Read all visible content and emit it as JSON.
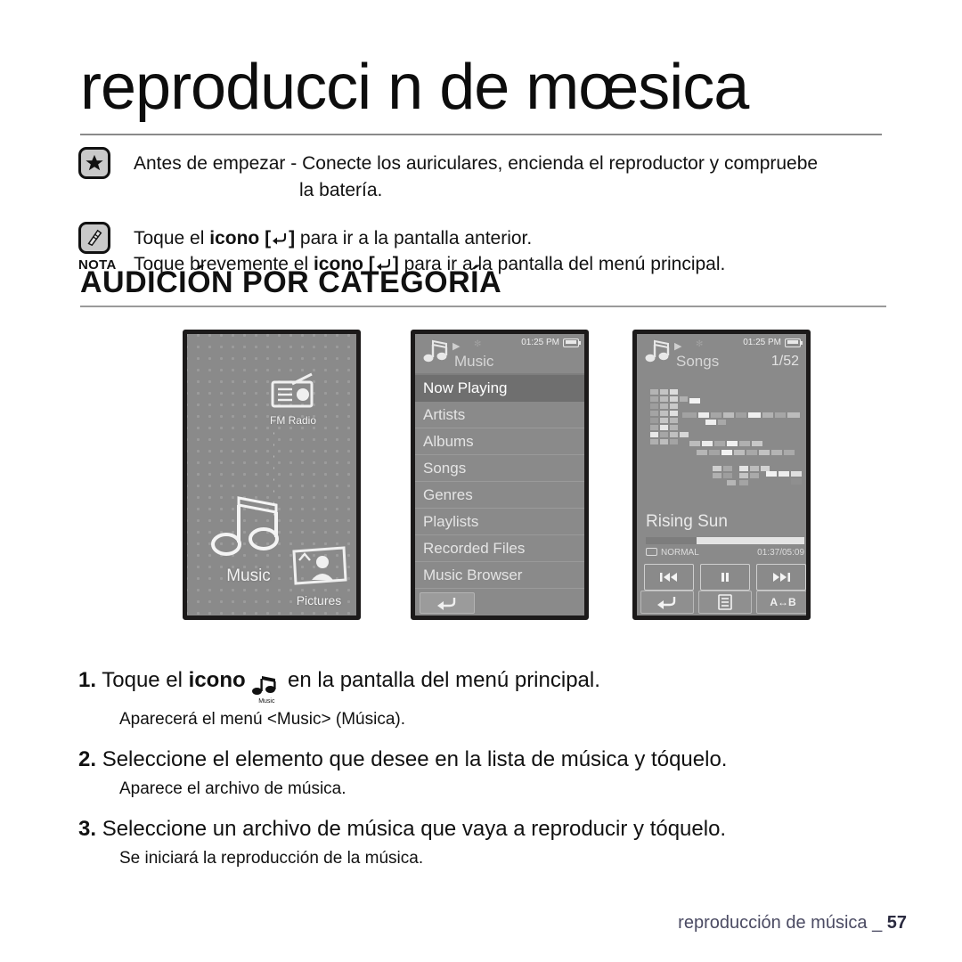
{
  "title": "reproducci n de mœsica",
  "notes": [
    {
      "icon": "star-icon",
      "label": "",
      "lines": [
        {
          "bold": "Antes de empezar - ",
          "text": "Conecte los auriculares, encienda el reproductor y compruebe",
          "indent": false
        },
        {
          "bold": "",
          "text": "la batería.",
          "indent": true
        }
      ]
    },
    {
      "icon": "note-pencil-icon",
      "label": "NOTA",
      "lines": [
        {
          "pre": "Toque el ",
          "bold": "icono [",
          "icon": "return-arrow-icon",
          "bold2": "]",
          "post": " para ir a la pantalla anterior."
        },
        {
          "pre": "Toque brevemente el ",
          "bold": "icono [",
          "icon": "return-arrow-icon",
          "bold2": "]",
          "post": " para ir a la pantalla del menú principal."
        }
      ]
    }
  ],
  "section": {
    "heading": "AUDICIÓN POR CATEGORÍA"
  },
  "devices": {
    "main_menu": {
      "icons": [
        {
          "name": "fm-radio-icon",
          "label": "FM Radio"
        },
        {
          "name": "music-icon",
          "label": "Music"
        },
        {
          "name": "pictures-icon",
          "label": "Pictures"
        }
      ]
    },
    "music_menu": {
      "header": {
        "title": "Music",
        "time": "01:25 PM",
        "battery": "full"
      },
      "items": [
        {
          "label": "Now Playing",
          "selected": true
        },
        {
          "label": "Artists",
          "selected": false
        },
        {
          "label": "Albums",
          "selected": false
        },
        {
          "label": "Songs",
          "selected": false
        },
        {
          "label": "Genres",
          "selected": false
        },
        {
          "label": "Playlists",
          "selected": false
        },
        {
          "label": "Recorded Files",
          "selected": false
        },
        {
          "label": "Music Browser",
          "selected": false
        }
      ],
      "back_button": "return-arrow-icon"
    },
    "now_playing": {
      "header": {
        "title": "Songs",
        "time": "01:25 PM",
        "count": "1/52",
        "battery": "full"
      },
      "track_title": "Rising Sun",
      "repeat_mode": "NORMAL",
      "elapsed_total": "01:37/05:09",
      "progress_percent": 32,
      "controls": [
        {
          "name": "previous-button",
          "glyph": "|◀◀"
        },
        {
          "name": "pause-button",
          "glyph": "❚❚"
        },
        {
          "name": "next-button",
          "glyph": "▶▶|"
        }
      ],
      "soft_keys": [
        {
          "name": "back-button",
          "glyph": ""
        },
        {
          "name": "menu-list-button",
          "glyph": ""
        },
        {
          "name": "ab-repeat-button",
          "glyph": "A↔B"
        }
      ]
    }
  },
  "steps": [
    {
      "num": "1.",
      "pre": "Toque el ",
      "bold": "icono",
      "icon": "music-icon",
      "icon_label": "Music",
      "post": " en la pantalla del menú principal.",
      "sub": "Aparecerá el menú <Music> (Música)."
    },
    {
      "num": "2.",
      "pre": "",
      "bold": "",
      "post": "Seleccione el elemento que desee en la lista de música y tóquelo.",
      "sub": "Aparece el archivo de música."
    },
    {
      "num": "3.",
      "pre": "",
      "bold": "",
      "post": "Seleccione un archivo de música que vaya a reproducir y tóquelo.",
      "sub": "Se iniciará la reproducción de la música."
    }
  ],
  "footer": {
    "text": "reproducción de música _",
    "page": "57"
  }
}
